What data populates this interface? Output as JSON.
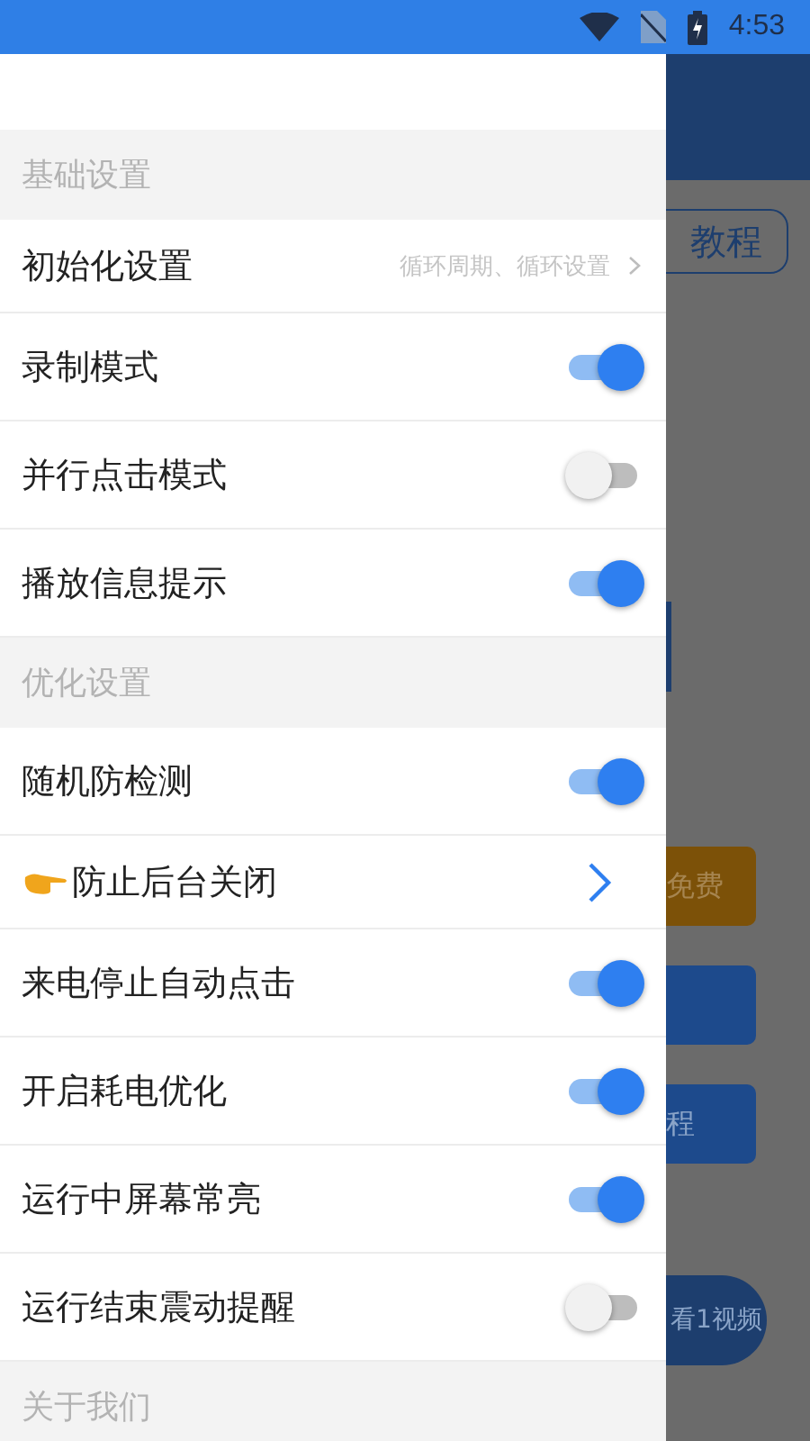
{
  "status_bar": {
    "time": "4:53"
  },
  "drawer": {
    "sections": [
      {
        "title": "基础设置",
        "items": [
          {
            "kind": "link",
            "label": "初始化设置",
            "hint": "循环周期、循环设置"
          },
          {
            "kind": "toggle",
            "label": "录制模式",
            "on": true
          },
          {
            "kind": "toggle",
            "label": "并行点击模式",
            "on": false
          },
          {
            "kind": "toggle",
            "label": "播放信息提示",
            "on": true
          }
        ]
      },
      {
        "title": "优化设置",
        "items": [
          {
            "kind": "toggle",
            "label": "随机防检测",
            "on": true
          },
          {
            "kind": "pointer",
            "label": "防止后台关闭"
          },
          {
            "kind": "toggle",
            "label": "来电停止自动点击",
            "on": true
          },
          {
            "kind": "toggle",
            "label": "开启耗电优化",
            "on": true
          },
          {
            "kind": "toggle",
            "label": "运行中屏幕常亮",
            "on": true
          },
          {
            "kind": "toggle",
            "label": "运行结束震动提醒",
            "on": false
          }
        ]
      },
      {
        "title": "关于我们"
      }
    ]
  },
  "background": {
    "tutorial_button": "教程",
    "free_button": "免费",
    "course_button": "程",
    "video_button": "看1视频"
  }
}
